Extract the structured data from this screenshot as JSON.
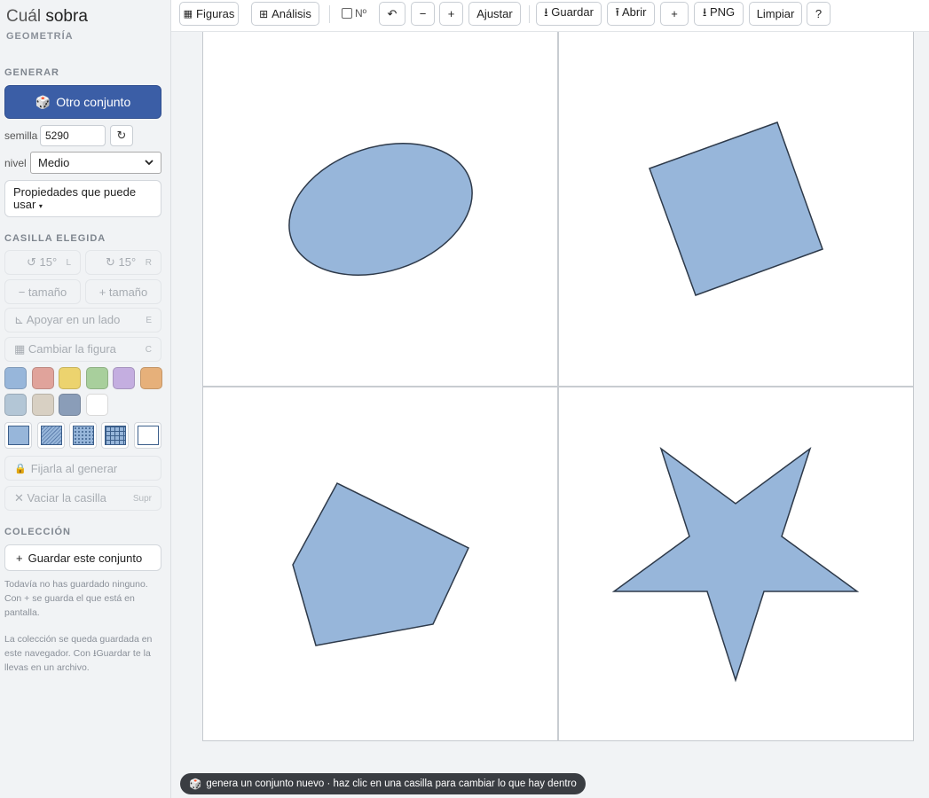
{
  "brand": {
    "light": "Cuál",
    "bold": "sobra",
    "subtitle": "GEOMETRÍA"
  },
  "sidebar": {
    "generate_heading": "GENERAR",
    "generate_button": "Otro conjunto",
    "seed_label": "semilla",
    "seed_value": "5290",
    "refresh_icon": "↻",
    "level_label": "nivel",
    "level_value": "Medio",
    "properties_label": "Propiedades que puede usar",
    "cell_heading": "CASILLA ELEGIDA",
    "rotate_left": {
      "label": "↺ 15°",
      "key": "L"
    },
    "rotate_right": {
      "label": "↻ 15°",
      "key": "R"
    },
    "size_down": "− tamaño",
    "size_up": "+ tamaño",
    "rest_side": {
      "label": "⊾ Apoyar en un lado",
      "key": "E"
    },
    "change_figure": {
      "label": "▦ Cambiar la figura",
      "key": "C"
    },
    "colors": [
      "#97b6da",
      "#e0a39b",
      "#ecd36e",
      "#a8cf9c",
      "#c4aee0",
      "#e6b07a",
      "#b3c6d6",
      "#d8d0c3",
      "#8a9db8",
      "#ffffff"
    ],
    "patterns": [
      "solid",
      "hatch",
      "dots",
      "grid",
      "empty"
    ],
    "lock": "Fijarla al generar",
    "clear": {
      "label": "✕ Vaciar la casilla",
      "key": "Supr"
    },
    "collection_heading": "COLECCIÓN",
    "save_set": "Guardar este conjunto",
    "note1": "Todavía no has guardado ninguno. Con  +  se guarda el que está en pantalla.",
    "note2": "La colección se queda guardada en este navegador. Con ⭳Guardar te la llevas en un archivo."
  },
  "toolbar": {
    "figures": "Figuras",
    "analysis": "Análisis",
    "number_toggle": "Nº",
    "undo": "↶",
    "zoom_out": "−",
    "zoom_in": "+",
    "fit": "Ajustar",
    "save": "⭳ Guardar",
    "open": "⭱ Abrir",
    "add": "+",
    "png": "⭳ PNG",
    "clear": "Limpiar",
    "help": "?"
  },
  "canvas": {
    "fill": "#97b6da",
    "stroke": "#2e3a4a",
    "cells": [
      {
        "shape": "ellipse"
      },
      {
        "shape": "square"
      },
      {
        "shape": "pentagon"
      },
      {
        "shape": "star"
      }
    ]
  },
  "status": "genera un conjunto nuevo · haz clic en una casilla para cambiar lo que hay dentro"
}
